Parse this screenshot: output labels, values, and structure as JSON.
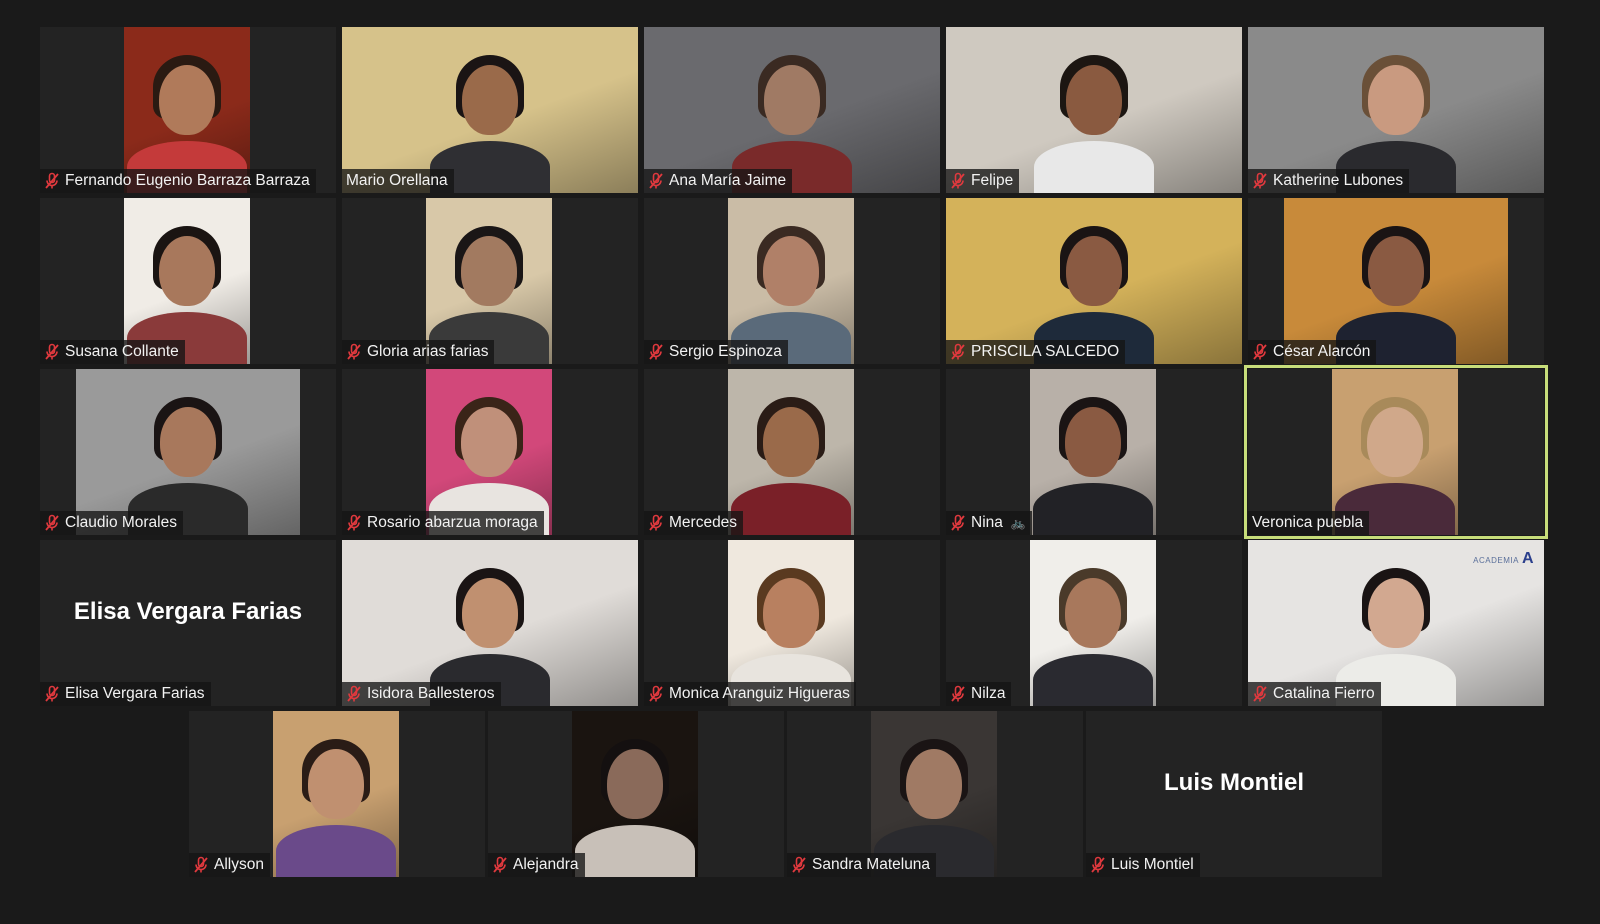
{
  "meeting": {
    "participants": [
      {
        "name": "Fernando Eugenio Barraza Barraza",
        "muted": true,
        "video": "mid",
        "bg": "#8b2a1a",
        "skin": "#b07a5a",
        "hair": "#2a1a12",
        "shirt": "#c43a3a"
      },
      {
        "name": "Mario Orellana",
        "muted": false,
        "video": "full",
        "bg": "#d6c28a",
        "skin": "#9a6a4a",
        "hair": "#1a1414",
        "shirt": "#2f2f33"
      },
      {
        "name": "Ana María Jaime",
        "muted": true,
        "video": "full",
        "bg": "#6a6a6e",
        "skin": "#a07a64",
        "hair": "#3a2a22",
        "shirt": "#7a2a2a"
      },
      {
        "name": "Felipe",
        "muted": true,
        "video": "full",
        "bg": "#cfc9c0",
        "skin": "#8a5a40",
        "hair": "#1c1612",
        "shirt": "#e8e8e8"
      },
      {
        "name": "Katherine Lubones",
        "muted": true,
        "video": "full",
        "bg": "#8a8a8a",
        "skin": "#c99a80",
        "hair": "#6a5038",
        "shirt": "#2a2a2e"
      },
      {
        "name": "Susana Collante",
        "muted": true,
        "video": "mid",
        "bg": "#f0ece6",
        "skin": "#a8785c",
        "hair": "#1a1412",
        "shirt": "#8a3a3a"
      },
      {
        "name": "Gloria arias farias",
        "muted": true,
        "video": "mid",
        "bg": "#d8c8a8",
        "skin": "#a27a60",
        "hair": "#1a1616",
        "shirt": "#3a3a3a"
      },
      {
        "name": "Sergio Espinoza",
        "muted": true,
        "video": "mid",
        "bg": "#cabca6",
        "skin": "#b08068",
        "hair": "#3a2a22",
        "shirt": "#5a6a7a"
      },
      {
        "name": "PRISCILA SALCEDO",
        "muted": true,
        "video": "full",
        "bg": "#d4b25a",
        "skin": "#8a5a42",
        "hair": "#1a1414",
        "shirt": "#1e2a3a"
      },
      {
        "name": "César Alarcón",
        "muted": true,
        "video": "wide",
        "bg": "#c88a3a",
        "skin": "#8a5a42",
        "hair": "#1a1414",
        "shirt": "#1e2230"
      },
      {
        "name": "Claudio Morales",
        "muted": true,
        "video": "wide",
        "bg": "#9a9a9a",
        "skin": "#a8785c",
        "hair": "#1a1414",
        "shirt": "#2a2a2a"
      },
      {
        "name": "Rosario abarzua moraga",
        "muted": true,
        "video": "mid",
        "bg": "#d2487a",
        "skin": "#c0907a",
        "hair": "#3a2418",
        "shirt": "#e8e4e0"
      },
      {
        "name": "Mercedes",
        "muted": true,
        "video": "mid",
        "bg": "#bdb6aa",
        "skin": "#9a6a4a",
        "hair": "#2a1c16",
        "shirt": "#7a2028"
      },
      {
        "name": "Nina",
        "muted": true,
        "video": "mid",
        "bg": "#b8b0a8",
        "skin": "#8a5a42",
        "hair": "#1a1414",
        "shirt": "#222226",
        "suffix": "🚲"
      },
      {
        "name": "Veronica puebla",
        "muted": false,
        "video": "mid",
        "bg": "#c8a070",
        "skin": "#d0a88a",
        "hair": "#a88a5a",
        "shirt": "#4a2a3a",
        "active": true
      },
      {
        "name": "Elisa Vergara Farias",
        "muted": true,
        "video": "none",
        "placeholder": "Elisa Vergara Farias"
      },
      {
        "name": "Isidora Ballesteros",
        "muted": true,
        "video": "full",
        "bg": "#e0dcd8",
        "skin": "#c09070",
        "hair": "#1a1414",
        "shirt": "#2a2a2e"
      },
      {
        "name": "Monica Aranguiz Higueras",
        "muted": true,
        "video": "mid",
        "bg": "#efe8de",
        "skin": "#b88060",
        "hair": "#5a3a20",
        "shirt": "#e8e4de"
      },
      {
        "name": "Nilza",
        "muted": true,
        "video": "mid",
        "bg": "#f0eeea",
        "skin": "#a8785c",
        "hair": "#4a3a2a",
        "shirt": "#2a2a30"
      },
      {
        "name": "Catalina Fierro",
        "muted": true,
        "video": "full",
        "bg": "#e6e4e2",
        "skin": "#d2a890",
        "hair": "#1a1414",
        "shirt": "#ecece8",
        "brand": {
          "small": "ACADEMIA",
          "big": "A"
        }
      },
      {
        "name": "Allyson",
        "muted": true,
        "video": "mid",
        "bg": "#c8a070",
        "skin": "#c09070",
        "hair": "#2a1c16",
        "shirt": "#6a4a8a"
      },
      {
        "name": "Alejandra",
        "muted": true,
        "video": "mid",
        "bg": "#1a1410",
        "skin": "#8a6a5a",
        "hair": "#141010",
        "shirt": "#c8c0b8"
      },
      {
        "name": "Sandra Mateluna",
        "muted": true,
        "video": "mid",
        "bg": "#3a3634",
        "skin": "#a07a64",
        "hair": "#1a1414",
        "shirt": "#2a2a2e"
      },
      {
        "name": "Luis Montiel",
        "muted": true,
        "video": "none",
        "placeholder": "Luis Montiel"
      }
    ]
  }
}
